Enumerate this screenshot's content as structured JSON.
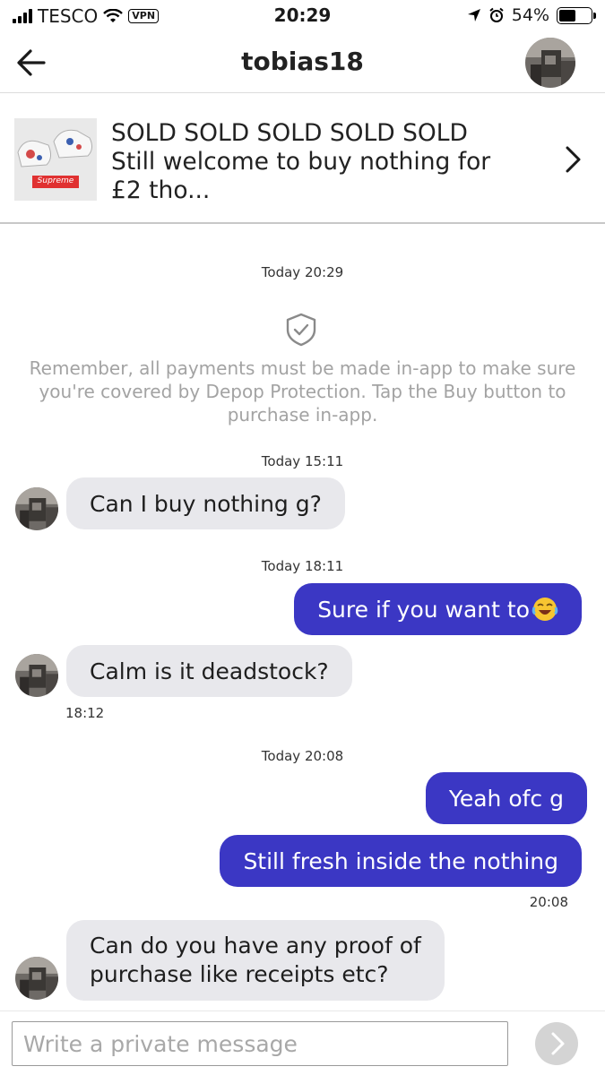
{
  "status_bar": {
    "carrier": "TESCO",
    "vpn": "VPN",
    "time": "20:29",
    "battery": "54%",
    "battery_level": 0.54
  },
  "header": {
    "title": "tobias18"
  },
  "listing": {
    "line1": "SOLD SOLD SOLD SOLD SOLD",
    "line2": "Still welcome to buy nothing for",
    "line3": "£2 tho...",
    "thumb_brand": "Supreme"
  },
  "chat": {
    "top_timestamp": "Today 20:29",
    "notice": "Remember, all payments must be made in-app to make sure you're covered by Depop Protection. Tap the Buy button to purchase in-app.",
    "messages": [
      {
        "date": "Today 15:11",
        "from": "them",
        "text": "Can I buy nothing g?"
      },
      {
        "date": "Today 18:11",
        "from": "me",
        "text": "Sure if you want to"
      },
      {
        "from": "them",
        "text": "Calm is it deadstock?",
        "time": "18:12"
      },
      {
        "date": "Today 20:08",
        "from": "me",
        "text": "Yeah ofc g"
      },
      {
        "from": "me",
        "text": "Still fresh inside the nothing",
        "time": "20:08"
      },
      {
        "from": "them",
        "text_line1": "Can do you have any proof of",
        "text_line2": "purchase like receipts etc?"
      }
    ]
  },
  "composer": {
    "placeholder": "Write a private message"
  },
  "colors": {
    "outgoing_bubble": "#3b37c4",
    "incoming_bubble": "#e8e8ec"
  }
}
